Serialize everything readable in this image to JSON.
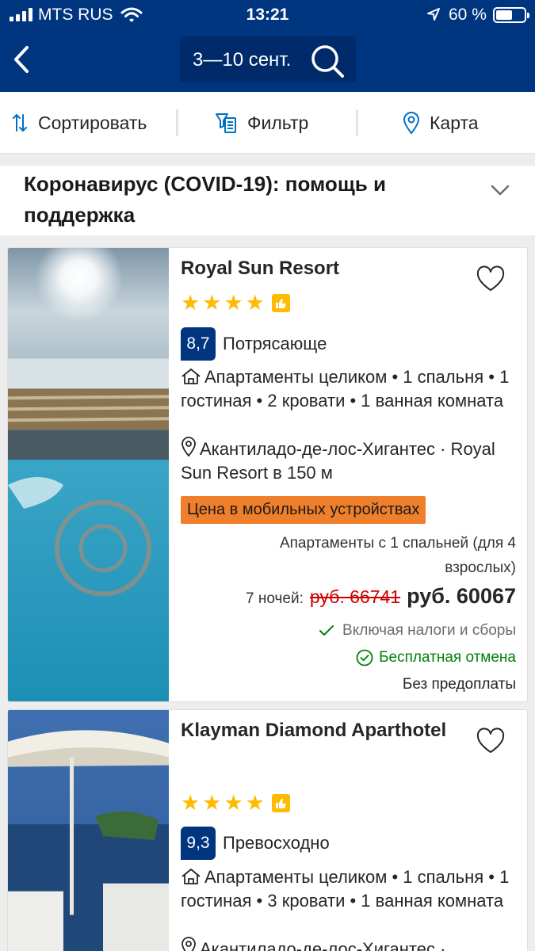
{
  "status_bar": {
    "carrier": "MTS RUS",
    "time": "13:21",
    "battery": "60 %",
    "battery_level": 0.6
  },
  "header": {
    "dates": "3—10 сент."
  },
  "toolbar": {
    "sort_label": "Сортировать",
    "filter_label": "Фильтр",
    "map_label": "Карта"
  },
  "covid": {
    "title": "Коронавирус (COVID-19): помощь и поддержка"
  },
  "hotels": [
    {
      "name": "Royal Sun Resort",
      "stars": 4,
      "score": "8,7",
      "score_text": "Потрясающе",
      "description": "Апартаменты целиком • 1 спальня • 1 гостиная • 2 кровати • 1 ванная комната",
      "location": "Акантиладо-де-лос-Хигантес · Royal Sun Resort в 150 м",
      "mobile_badge": "Цена в мобильных устройствах",
      "room": "Апартаменты с 1 спальней (для 4 взрослых)",
      "nights": "7 ночей:",
      "old_price": "руб. 66741",
      "price": "руб. 60067",
      "taxes": "Включая налоги и сборы",
      "cancellation": "Бесплатная отмена",
      "prepayment": "Без предоплаты"
    },
    {
      "name": "Klayman Diamond Aparthotel",
      "stars": 4,
      "score": "9,3",
      "score_text": "Превосходно",
      "description": "Апартаменты целиком • 1 спальня • 1 гостиная • 3 кровати • 1 ванная комната",
      "location": "Акантиладо-де-лос-Хигантес ·"
    }
  ]
}
